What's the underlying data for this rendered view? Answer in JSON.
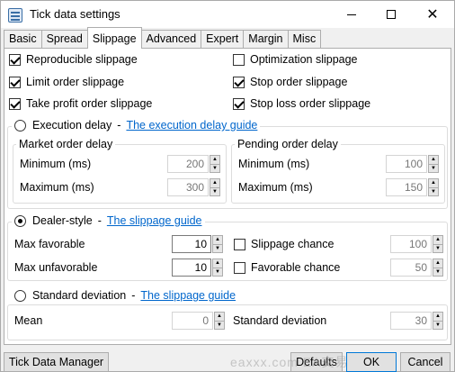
{
  "window": {
    "title": "Tick data settings"
  },
  "tabs": [
    "Basic",
    "Spread",
    "Slippage",
    "Advanced",
    "Expert",
    "Margin",
    "Misc"
  ],
  "active_tab": "Slippage",
  "checkboxes": {
    "reproducible": {
      "label": "Reproducible slippage",
      "checked": true
    },
    "optimization": {
      "label": "Optimization slippage",
      "checked": false
    },
    "limit_order": {
      "label": "Limit order slippage",
      "checked": true
    },
    "stop_order": {
      "label": "Stop order slippage",
      "checked": true
    },
    "take_profit": {
      "label": "Take profit order slippage",
      "checked": true
    },
    "stop_loss": {
      "label": "Stop loss order slippage",
      "checked": true
    }
  },
  "execution_delay": {
    "label": "Execution delay",
    "separator": "-",
    "guide_link": "The execution delay guide",
    "selected": false,
    "market": {
      "title": "Market order delay",
      "minimum_label": "Minimum (ms)",
      "minimum": "200",
      "maximum_label": "Maximum (ms)",
      "maximum": "300"
    },
    "pending": {
      "title": "Pending order delay",
      "minimum_label": "Minimum (ms)",
      "minimum": "100",
      "maximum_label": "Maximum (ms)",
      "maximum": "150"
    }
  },
  "dealer_style": {
    "label": "Dealer-style",
    "separator": "-",
    "guide_link": "The slippage guide",
    "selected": true,
    "max_favorable_label": "Max favorable",
    "max_favorable": "10",
    "max_unfavorable_label": "Max unfavorable",
    "max_unfavorable": "10",
    "slippage_chance_label": "Slippage chance",
    "slippage_chance": "100",
    "slippage_chance_checked": false,
    "favorable_chance_label": "Favorable chance",
    "favorable_chance": "50",
    "favorable_chance_checked": false
  },
  "standard_deviation": {
    "label": "Standard deviation",
    "separator": "-",
    "guide_link": "The slippage guide",
    "selected": false,
    "mean_label": "Mean",
    "mean": "0",
    "stddev_label": "Standard deviation",
    "stddev": "30"
  },
  "buttons": {
    "tick_data_manager": "Tick Data Manager",
    "defaults": "Defaults",
    "ok": "OK",
    "cancel": "Cancel"
  },
  "watermark": "eaxxx.com EA交易"
}
